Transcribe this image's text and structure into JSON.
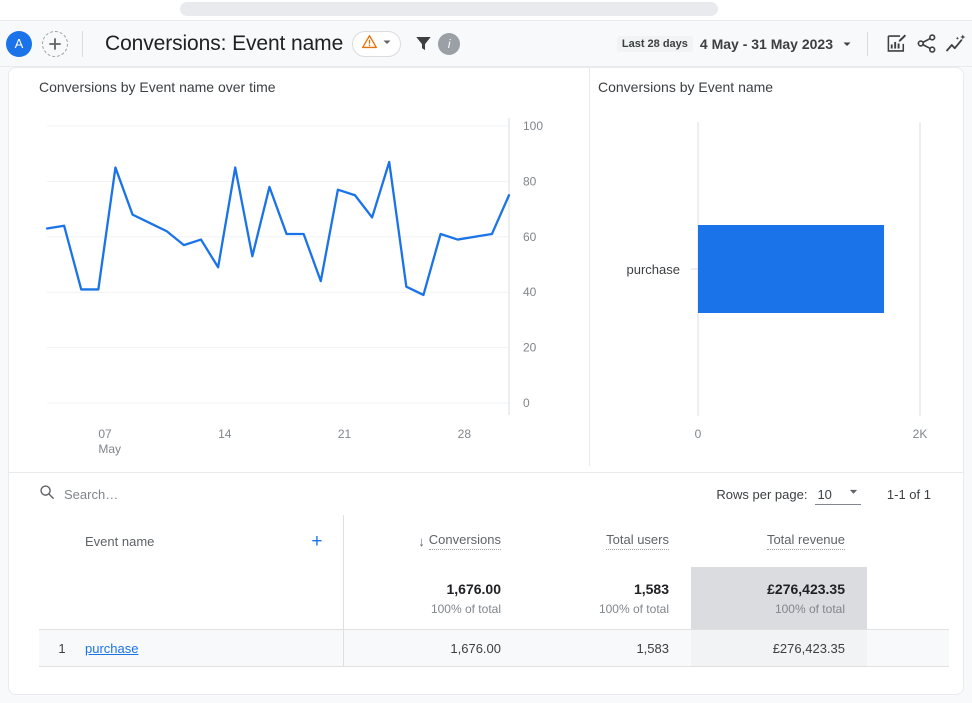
{
  "page": {
    "background_color": "#f8f9fa",
    "card_background": "#ffffff",
    "accent_color": "#1a73e8",
    "warning_color": "#e8710a"
  },
  "header": {
    "avatar_initial": "A",
    "add_icon": "plus-circle-icon",
    "title": "Conversions: Event name",
    "warning_icon": "warning-triangle-icon",
    "warning_caret_icon": "chevron-down-icon",
    "filter_icon": "funnel-icon",
    "info_avatar_letter": "i",
    "date_badge": "Last 28 days",
    "date_range": "4 May - 31 May 2023",
    "date_caret_icon": "chevron-down-icon",
    "edit_chart_icon": "edit-chart-icon",
    "share_icon": "share-icon",
    "insights_icon": "insights-sparkline-icon"
  },
  "line_chart_panel": {
    "title": "Conversions by Event name over time"
  },
  "bar_chart_panel": {
    "title": "Conversions by Event name"
  },
  "toolbar": {
    "search_icon": "search-icon",
    "search_value": "",
    "search_placeholder": "Search…",
    "rows_per_page_label": "Rows per page:",
    "rows_per_page_value": "10",
    "rows_per_page_caret_icon": "caret-down-icon",
    "pager_text": "1-1 of 1"
  },
  "table": {
    "dimension_header": "Event name",
    "add_dimension_icon": "plus-icon",
    "add_dimension_label": "+",
    "sort_arrow": "↓",
    "metric_headers": [
      "Conversions",
      "Total users",
      "Total revenue"
    ],
    "totals": {
      "values": [
        "1,676.00",
        "1,583",
        "£276,423.35"
      ],
      "subtexts": [
        "100% of total",
        "100% of total",
        "100% of total"
      ],
      "highlight_column_index": 2
    },
    "rows": [
      {
        "rank": "1",
        "dimension": "purchase",
        "values": [
          "1,676.00",
          "1,583",
          "£276,423.35"
        ]
      }
    ]
  },
  "chart_data": [
    {
      "type": "line",
      "title": "Conversions by Event name over time",
      "xlabel": "",
      "ylabel": "",
      "ylim": [
        0,
        100
      ],
      "yticks": [
        0,
        20,
        40,
        60,
        80,
        100
      ],
      "grid": true,
      "legend": "none",
      "x_tick_labels": [
        "07\nMay",
        "14",
        "21",
        "28"
      ],
      "x_tick_indices": [
        3,
        10,
        17,
        24
      ],
      "x": [
        "4 May",
        "5 May",
        "6 May",
        "7 May",
        "8 May",
        "9 May",
        "10 May",
        "11 May",
        "12 May",
        "13 May",
        "14 May",
        "15 May",
        "16 May",
        "17 May",
        "18 May",
        "19 May",
        "20 May",
        "21 May",
        "22 May",
        "23 May",
        "24 May",
        "25 May",
        "26 May",
        "27 May",
        "28 May",
        "29 May",
        "30 May",
        "31 May"
      ],
      "series": [
        {
          "name": "purchase",
          "color": "#1a73e8",
          "values": [
            63,
            64,
            41,
            41,
            85,
            68,
            65,
            62,
            57,
            59,
            49,
            85,
            53,
            78,
            61,
            61,
            44,
            77,
            75,
            67,
            87,
            42,
            39,
            61,
            59,
            60,
            61,
            75
          ]
        }
      ]
    },
    {
      "type": "bar",
      "orientation": "horizontal",
      "title": "Conversions by Event name",
      "categories": [
        "purchase"
      ],
      "values": [
        1676
      ],
      "xlim": [
        0,
        2000
      ],
      "xticks": [
        0,
        2000
      ],
      "x_tick_labels": [
        "0",
        "2K"
      ],
      "ylabel": "",
      "xlabel": "",
      "grid": false,
      "legend": "none",
      "bar_color": "#1a73e8"
    }
  ]
}
